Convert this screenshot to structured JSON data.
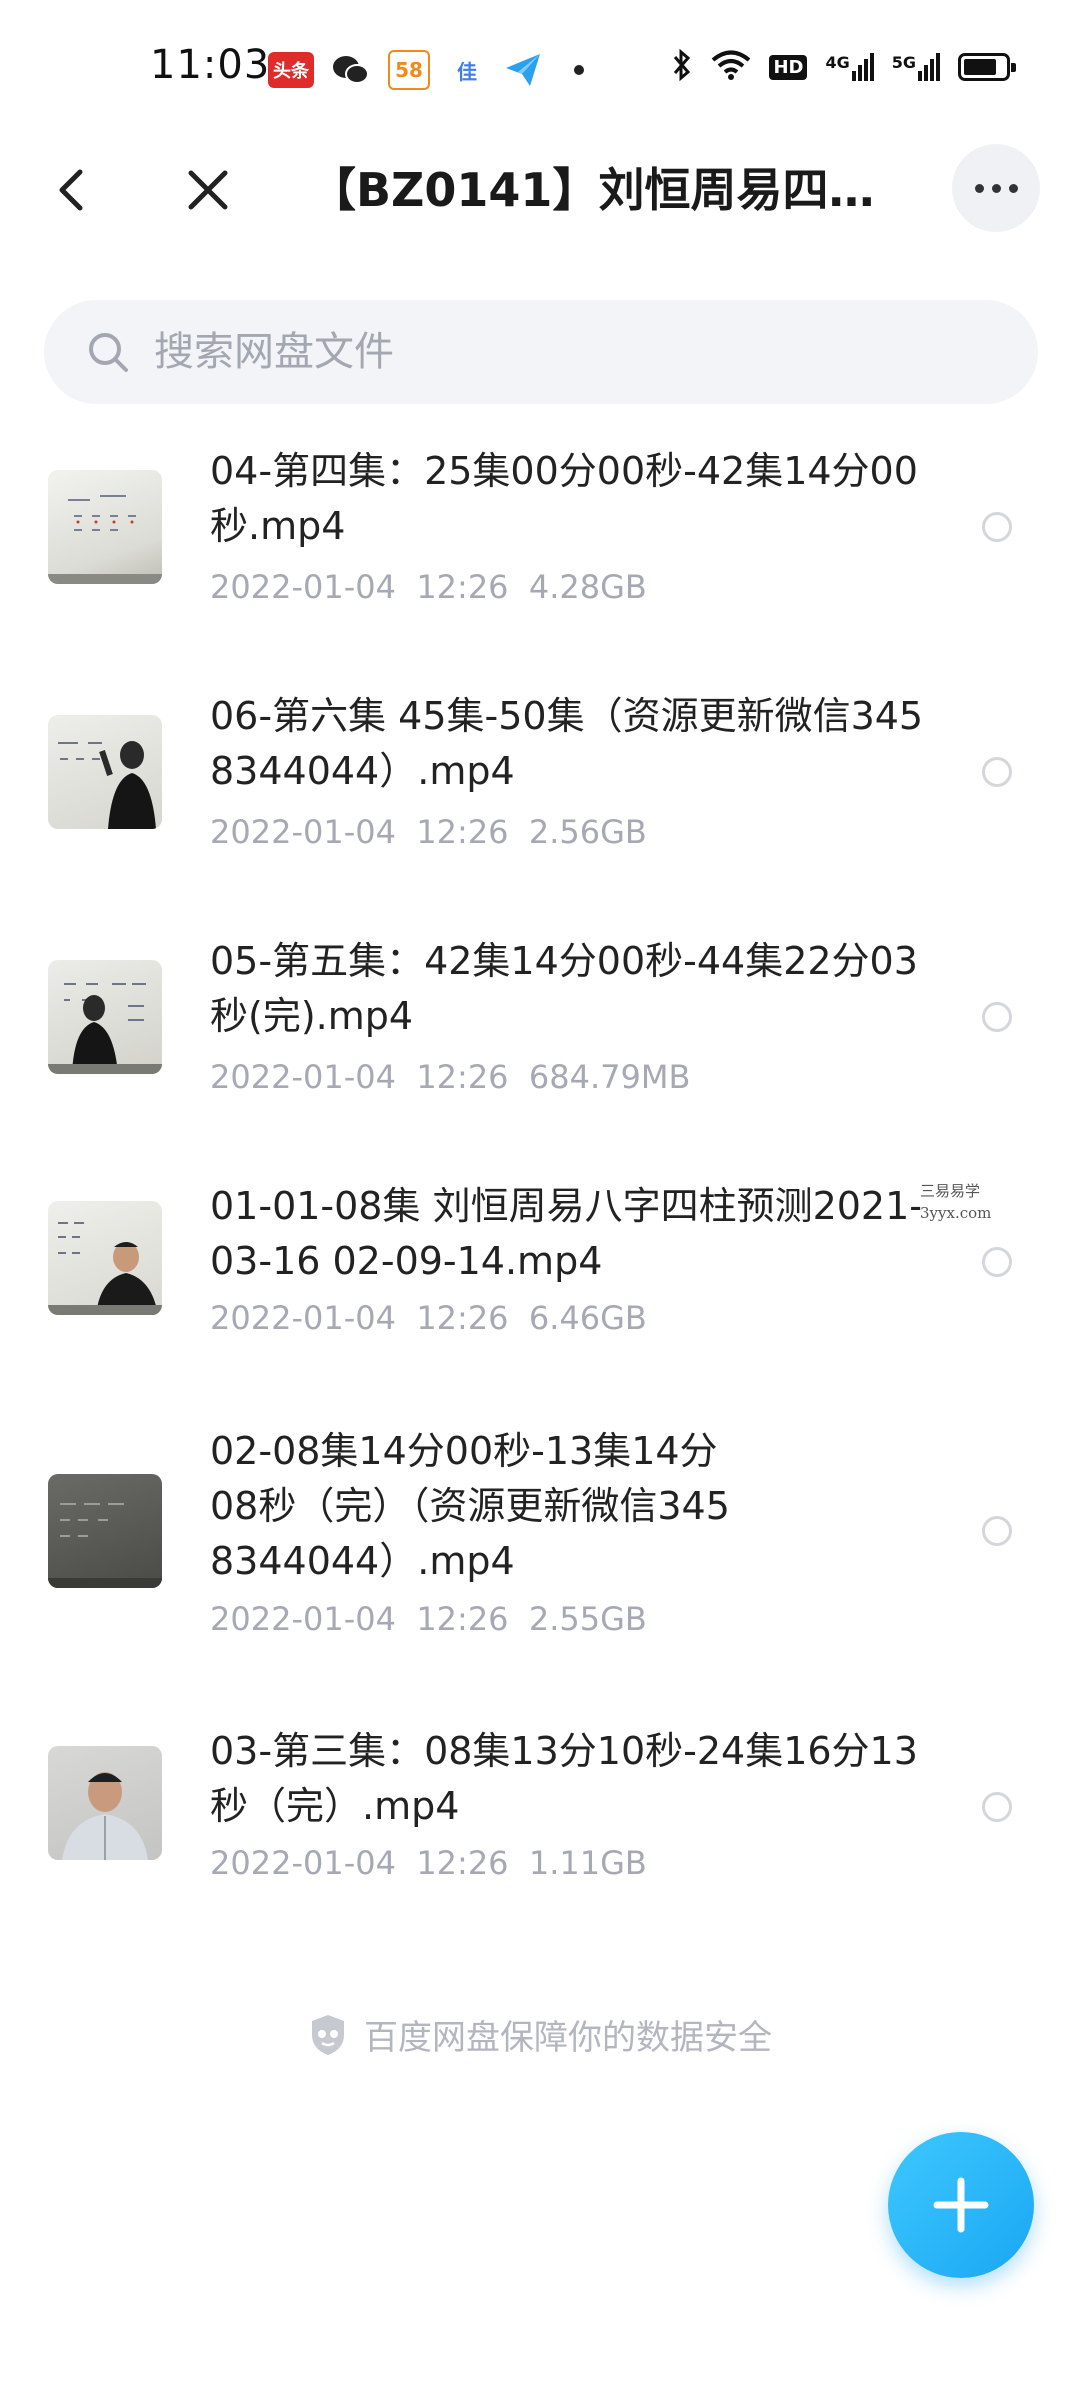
{
  "status_bar": {
    "time": "11:03",
    "apps": [
      {
        "icon": "toutiao-icon",
        "text": "头条",
        "color": "#e02b2b"
      },
      {
        "icon": "wechat-icon",
        "text": "",
        "color": "#222222"
      },
      {
        "icon": "58-icon",
        "text": "58",
        "color": "#f08a1c"
      },
      {
        "icon": "jia-icon",
        "text": "佳",
        "color": "#3f7ee8"
      },
      {
        "icon": "paper-plane-icon",
        "text": "",
        "color": "#2aa0ef"
      }
    ],
    "network_label": "HD",
    "network_4g": "4G",
    "network_5g": "5G",
    "battery_level": 0.8
  },
  "header": {
    "title": "【BZ0141】刘恒周易四柱..."
  },
  "search": {
    "placeholder": "搜索网盘文件"
  },
  "files": [
    {
      "name": "04-第四集：25集00分00秒-42集14分00秒.mp4",
      "date": "2022-01-04",
      "time": "12:26",
      "size": "4.28GB"
    },
    {
      "name": "06-第六集 45集-50集（资源更新微信3458344044）.mp4",
      "date": "2022-01-04",
      "time": "12:26",
      "size": "2.56GB"
    },
    {
      "name": "05-第五集：42集14分00秒-44集22分03秒(完).mp4",
      "date": "2022-01-04",
      "time": "12:26",
      "size": "684.79MB"
    },
    {
      "name": "01-01-08集 刘恒周易八字四柱预测2021-03-16 02-09-14.mp4",
      "date": "2022-01-04",
      "time": "12:26",
      "size": "6.46GB"
    },
    {
      "name": "02-08集14分00秒-13集14分08秒（完）（资源更新微信3458344044）.mp4",
      "date": "2022-01-04",
      "time": "12:26",
      "size": "2.55GB"
    },
    {
      "name": "03-第三集：08集13分10秒-24集16分13秒（完）.mp4",
      "date": "2022-01-04",
      "time": "12:26",
      "size": "1.11GB"
    }
  ],
  "watermark": {
    "line1": "三易易学",
    "line2": "3yyx.com"
  },
  "footer": {
    "security_text": "百度网盘保障你的数据安全"
  },
  "colors": {
    "accent": "#1aa7f2",
    "meta_text": "#a6a9b3",
    "search_bg": "#f3f4f8"
  }
}
